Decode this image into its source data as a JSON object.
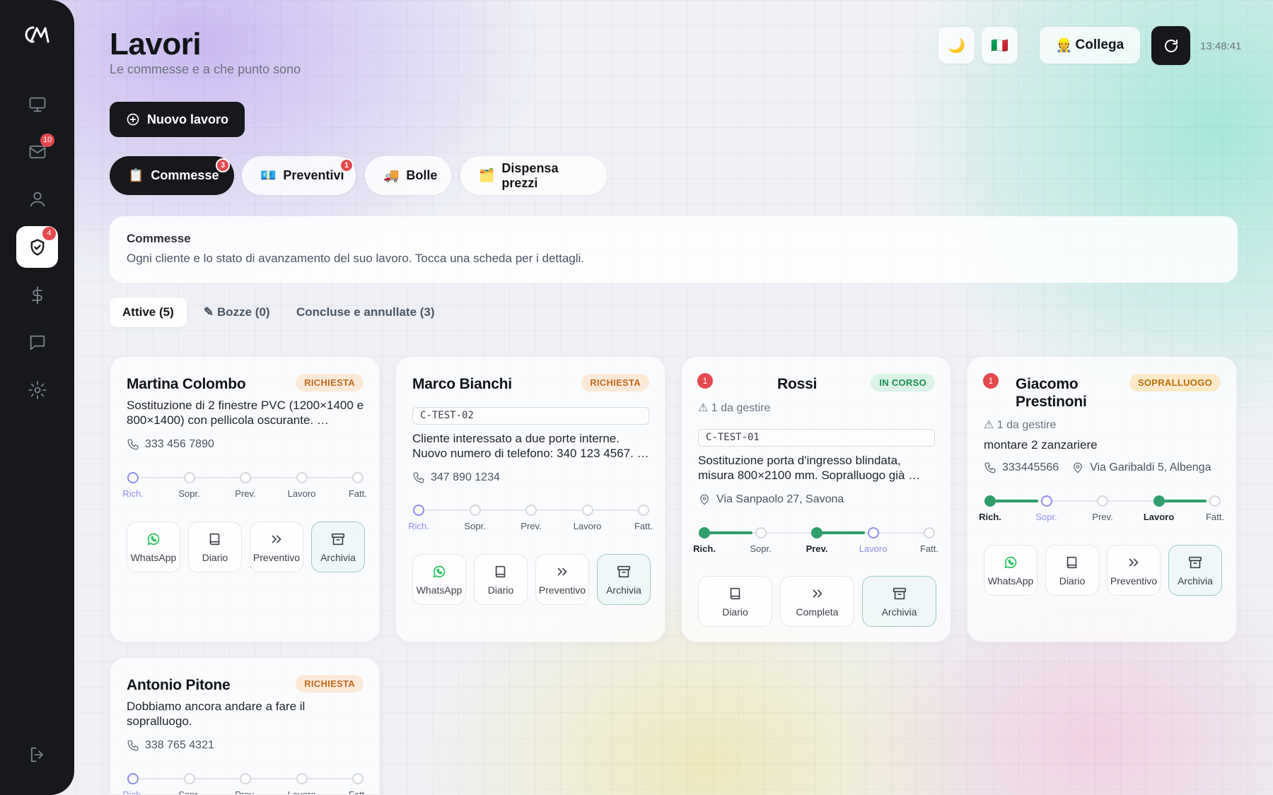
{
  "sidebar": {
    "items": [
      {
        "icon": "monitor-icon",
        "badge": ""
      },
      {
        "icon": "mail-icon",
        "badge": "10"
      },
      {
        "icon": "user-icon",
        "badge": ""
      },
      {
        "icon": "shield-check-icon",
        "badge": "4",
        "active": true
      },
      {
        "icon": "dollar-icon",
        "badge": ""
      },
      {
        "icon": "chat-icon",
        "badge": ""
      },
      {
        "icon": "gear-icon",
        "badge": ""
      }
    ],
    "logout_icon": "logout-icon"
  },
  "header": {
    "title": "Lavori",
    "subtitle": "Le commesse e a che punto sono",
    "theme_icon": "🌙",
    "flag_icon": "🇮🇹",
    "collega_emoji": "👷",
    "collega_label": "Collega",
    "time": "13:48:41"
  },
  "new_button": {
    "label": "Nuovo lavoro"
  },
  "tabs": [
    {
      "emoji": "📋",
      "label": "Commesse",
      "badge": "3",
      "active": true
    },
    {
      "emoji": "💶",
      "label": "Preventivi",
      "badge": "1"
    },
    {
      "emoji": "🚚",
      "label": "Bolle",
      "badge": ""
    },
    {
      "emoji": "🗂️",
      "label": "Dispensa prezzi",
      "badge": ""
    }
  ],
  "info": {
    "title": "Commesse",
    "description": "Ogni cliente e lo stato di avanzamento del suo lavoro. Tocca una scheda per i dettagli."
  },
  "filters": [
    {
      "label": "Attive (5)",
      "active": true
    },
    {
      "label": "✎ Bozze (0)"
    },
    {
      "label": "Concluse e annullate (3)"
    }
  ],
  "stage_labels": [
    "Rich.",
    "Sopr.",
    "Prev.",
    "Lavoro",
    "Fatt."
  ],
  "accent_colors": {
    "done": "#2e9e6b",
    "current": "#8c8ef0",
    "alert": "#e5484d"
  },
  "cards": [
    {
      "name": "Martina Colombo",
      "status": "RICHIESTA",
      "description": "Sostituzione di 2 finestre PVC (1200×1400 e 800×1400) con pellicola oscurante. …",
      "phone": "333 456 7890",
      "actions": [
        "WhatsApp",
        "Diario",
        "Preventivo",
        "Archivia"
      ]
    },
    {
      "name": "Marco Bianchi",
      "status": "RICHIESTA",
      "code": "C-TEST-02",
      "description": "Cliente interessato a due porte interne. Nuovo numero di telefono: 340 123 4567. …",
      "phone": "347 890 1234",
      "actions": [
        "WhatsApp",
        "Diario",
        "Preventivo",
        "Archivia"
      ]
    },
    {
      "name": "Rossi",
      "status": "IN CORSO",
      "alert": "1",
      "todo": "⚠ 1 da gestire",
      "code": "C-TEST-01",
      "description": "Sostituzione porta d'ingresso blindata, misura 800×2100 mm. Sopralluogo già …",
      "address": "Via Sanpaolo 27, Savona",
      "actions": [
        "Diario",
        "Completa",
        "Archivia"
      ]
    },
    {
      "name": "Giacomo Prestinoni",
      "status": "SOPRALLUOGO",
      "alert": "1",
      "todo": "⚠ 1 da gestire",
      "description": "montare 2 zanzariere",
      "phone": "333445566",
      "address": "Via Garibaldi 5, Albenga",
      "actions": [
        "WhatsApp",
        "Diario",
        "Preventivo",
        "Archivia"
      ]
    },
    {
      "name": "Antonio Pitone",
      "status": "RICHIESTA",
      "description": "Dobbiamo ancora andare a fare il sopralluogo.",
      "phone": "338 765 4321"
    }
  ]
}
